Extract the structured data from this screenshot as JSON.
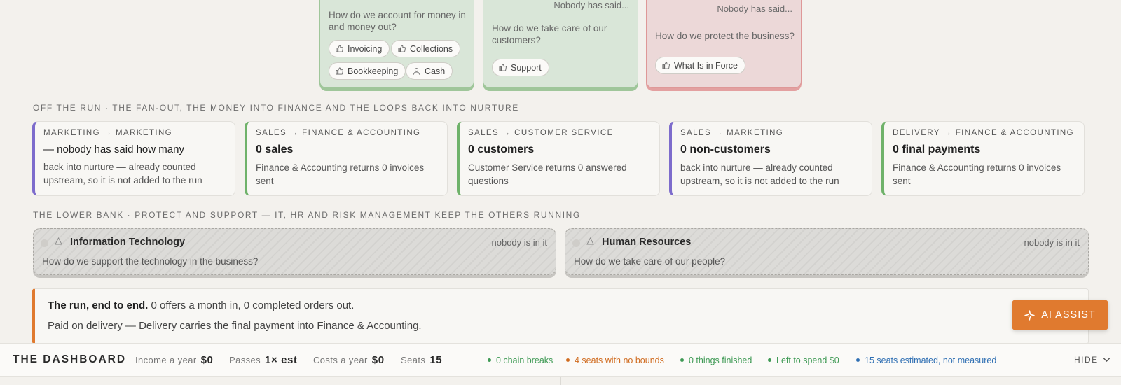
{
  "top_cards": [
    {
      "question": "How do we account for money in and money out?",
      "chips": [
        {
          "label": "Invoicing",
          "icon": "thumb-icon"
        },
        {
          "label": "Collections",
          "icon": "thumb-icon"
        },
        {
          "label": "Bookkeeping",
          "icon": "thumb-icon"
        },
        {
          "label": "Cash",
          "icon": "person-icon"
        }
      ]
    },
    {
      "nobody": "Nobody has said...",
      "question": "How do we take care of our customers?",
      "chips": [
        {
          "label": "Support",
          "icon": "thumb-icon"
        }
      ]
    },
    {
      "nobody": "Nobody has said...",
      "question": "How do we protect the business?",
      "chips": [
        {
          "label": "What Is in Force",
          "icon": "thumb-icon"
        }
      ]
    }
  ],
  "off_run": {
    "label": "OFF THE RUN · THE FAN-OUT, THE MONEY INTO FINANCE AND THE LOOPS BACK INTO NURTURE",
    "flows": [
      {
        "route": "MARKETING → MARKETING",
        "value": "— nobody has said how many",
        "desc": "back into nurture — already counted upstream, so it is not added to the run",
        "accent": "#7d6ccc"
      },
      {
        "route": "SALES → FINANCE & ACCOUNTING",
        "value": "0 sales",
        "desc": "Finance & Accounting returns 0 invoices sent",
        "accent": "#6fb26a"
      },
      {
        "route": "SALES → CUSTOMER SERVICE",
        "value": "0 customers",
        "desc": "Customer Service returns 0 answered questions",
        "accent": "#6fb26a"
      },
      {
        "route": "SALES → MARKETING",
        "value": "0 non-customers",
        "desc": "back into nurture — already counted upstream, so it is not added to the run",
        "accent": "#7d6ccc"
      },
      {
        "route": "DELIVERY → FINANCE & ACCOUNTING",
        "value": "0 final payments",
        "desc": "Finance & Accounting returns 0 invoices sent",
        "accent": "#6fb26a"
      }
    ]
  },
  "lower_bank": {
    "label": "THE LOWER BANK · PROTECT AND SUPPORT — IT, HR AND RISK MANAGEMENT KEEP THE OTHERS RUNNING",
    "units": [
      {
        "title": "Information Technology",
        "status": "nobody is in it",
        "question": "How do we support the technology in the business?"
      },
      {
        "title": "Human Resources",
        "status": "nobody is in it",
        "question": "How do we take care of our people?"
      }
    ]
  },
  "run": {
    "heading": "The run, end to end.",
    "summary": " 0 offers a month in, 0 completed orders out.",
    "detail": "Paid on delivery — Delivery carries the final payment into Finance & Accounting."
  },
  "ai_assist": {
    "label": "AI ASSIST",
    "color": "#e07a2f"
  },
  "dashboard": {
    "title": "THE DASHBOARD",
    "metrics": [
      {
        "label": "Income a year",
        "value": "$0"
      },
      {
        "label": "Passes",
        "value": "1× est"
      },
      {
        "label": "Costs a year",
        "value": "$0"
      },
      {
        "label": "Seats",
        "value": "15"
      }
    ],
    "statuses": [
      {
        "text": "0 chain breaks",
        "color": "#3f9a55"
      },
      {
        "text": "4 seats with no bounds",
        "color": "#d06b1f"
      },
      {
        "text": "0 things finished",
        "color": "#3f9a55"
      },
      {
        "text": "Left to spend $0",
        "color": "#3f9a55"
      },
      {
        "text": "15 seats estimated, not measured",
        "color": "#2f6fb3"
      }
    ],
    "hide_label": "HIDE"
  }
}
